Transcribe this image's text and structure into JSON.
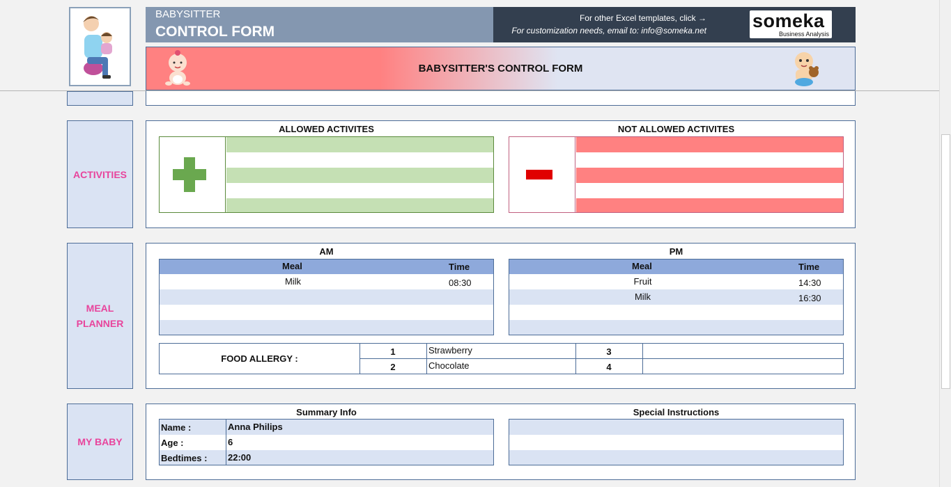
{
  "header": {
    "app_small": "BABYSITTER",
    "app_title": "CONTROL FORM",
    "promo_line1": "For other Excel templates, click →",
    "promo_line2": "For customization needs, email to: info@someka.net",
    "brand": "someka",
    "brand_tag": "Business Analysis",
    "banner_title": "BABYSITTER'S CONTROL FORM"
  },
  "activities": {
    "side_label": "ACTIVITIES",
    "allowed_title": "ALLOWED ACTIVITES",
    "not_allowed_title": "NOT ALLOWED ACTIVITES",
    "allowed_rows": [
      "",
      "",
      "",
      "",
      ""
    ],
    "not_allowed_rows": [
      "",
      "",
      "",
      "",
      ""
    ],
    "colors": {
      "allowed": "#c5e0b4",
      "not_allowed": "#ff8181",
      "plus": "#6aa84f",
      "minus": "#e00000"
    }
  },
  "meal": {
    "side_label_1": "MEAL",
    "side_label_2": "PLANNER",
    "am_title": "AM",
    "pm_title": "PM",
    "col_meal": "Meal",
    "col_time": "Time",
    "am_rows": [
      {
        "meal": "Milk",
        "time": "08:30"
      },
      {
        "meal": "",
        "time": ""
      },
      {
        "meal": "",
        "time": ""
      },
      {
        "meal": "",
        "time": ""
      }
    ],
    "pm_rows": [
      {
        "meal": "Fruit",
        "time": "14:30"
      },
      {
        "meal": "Milk",
        "time": "16:30"
      },
      {
        "meal": "",
        "time": ""
      },
      {
        "meal": "",
        "time": ""
      }
    ],
    "allergy_label": "FOOD ALLERGY :",
    "allergies": [
      {
        "num": "1",
        "name": "Strawberry"
      },
      {
        "num": "2",
        "name": "Chocolate"
      },
      {
        "num": "3",
        "name": ""
      },
      {
        "num": "4",
        "name": ""
      }
    ]
  },
  "baby": {
    "side_label": "MY BABY",
    "summary_title": "Summary Info",
    "special_title": "Special Instructions",
    "name_label": "Name :",
    "name_value": "Anna Philips",
    "age_label": "Age :",
    "age_value": "6",
    "bed_label": "Bedtimes :",
    "bed_value": "22:00"
  }
}
